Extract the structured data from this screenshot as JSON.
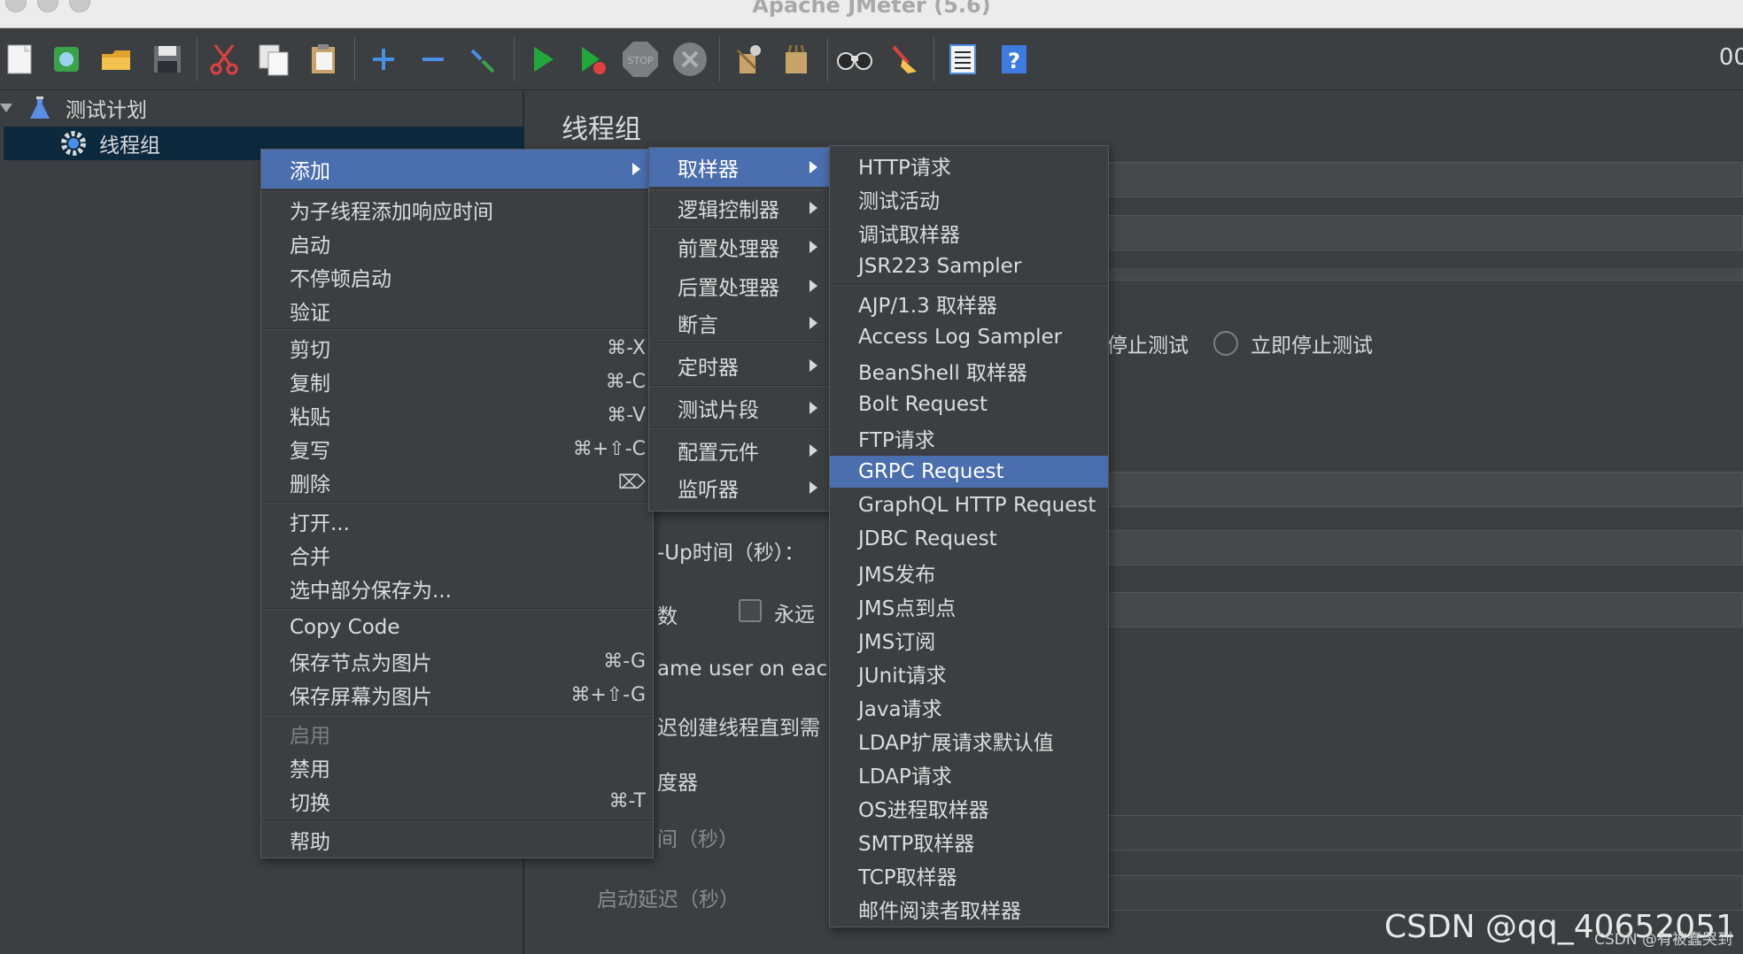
{
  "window": {
    "title": "Apache JMeter (5.6)"
  },
  "toolbar": {
    "elapsed": "00",
    "buttons": [
      "new-icon",
      "templates-icon",
      "open-icon",
      "save-icon",
      "cut-icon",
      "copy-icon",
      "paste-icon",
      "expand-icon",
      "collapse-icon",
      "toggle-icon",
      "start-icon",
      "start-no-pause-icon",
      "stop-icon",
      "shutdown-icon",
      "clear-icon",
      "clear-all-icon",
      "search-icon",
      "reset-search-icon",
      "function-helper-icon",
      "help-icon"
    ]
  },
  "tree": {
    "items": [
      {
        "label": "测试计划",
        "icon": "test-plan-flask-icon"
      },
      {
        "label": "线程组",
        "icon": "thread-group-gear-icon"
      }
    ]
  },
  "panel": {
    "title": "线程组",
    "stop_test": "停止测试",
    "stop_now": "立即停止测试",
    "rampup": "-Up时间（秒）：",
    "loop_frag": "数",
    "forever": "永远",
    "same_user": "ame user on each",
    "delay_create": "迟创建线程直到需",
    "scheduler": "度器",
    "duration": "间（秒）",
    "startup_delay": "启动延迟（秒）"
  },
  "context_menu": {
    "add": "添加",
    "group1": [
      "为子线程添加响应时间",
      "启动",
      "不停顿启动",
      "验证"
    ],
    "edit": [
      {
        "label": "剪切",
        "shortcut": "⌘-X"
      },
      {
        "label": "复制",
        "shortcut": "⌘-C"
      },
      {
        "label": "粘贴",
        "shortcut": "⌘-V"
      },
      {
        "label": "复写",
        "shortcut": "⌘+⇧-C"
      },
      {
        "label": "删除",
        "shortcut": "⌦"
      }
    ],
    "file": [
      "打开...",
      "合并",
      "选中部分保存为..."
    ],
    "copy_code": "Copy Code",
    "save_node_img": {
      "label": "保存节点为图片",
      "shortcut": "⌘-G"
    },
    "save_screen_img": {
      "label": "保存屏幕为图片",
      "shortcut": "⌘+⇧-G"
    },
    "enable": "启用",
    "disable": "禁用",
    "toggle": {
      "label": "切换",
      "shortcut": "⌘-T"
    },
    "help": "帮助"
  },
  "add_submenu": {
    "items": [
      "取样器",
      "逻辑控制器",
      "前置处理器",
      "后置处理器",
      "断言",
      "定时器",
      "测试片段",
      "配置元件",
      "监听器"
    ]
  },
  "sampler_submenu": {
    "group1": [
      "HTTP请求",
      "测试活动",
      "调试取样器",
      "JSR223 Sampler"
    ],
    "group2": [
      "AJP/1.3 取样器",
      "Access Log Sampler",
      "BeanShell 取样器",
      "Bolt Request",
      "FTP请求",
      "GRPC Request",
      "GraphQL HTTP Request",
      "JDBC Request",
      "JMS发布",
      "JMS点到点",
      "JMS订阅",
      "JUnit请求",
      "Java请求",
      "LDAP扩展请求默认值",
      "LDAP请求",
      "OS进程取样器",
      "SMTP取样器",
      "TCP取样器",
      "邮件阅读者取样器"
    ],
    "highlighted": "GRPC Request"
  },
  "watermark": {
    "main": "CSDN @qq_40652051",
    "sub": "CSDN @有被蠢哭到"
  },
  "colors": {
    "highlight": "#4b6eaf",
    "background": "#3c3f41",
    "selected_tree": "#0d293e"
  }
}
